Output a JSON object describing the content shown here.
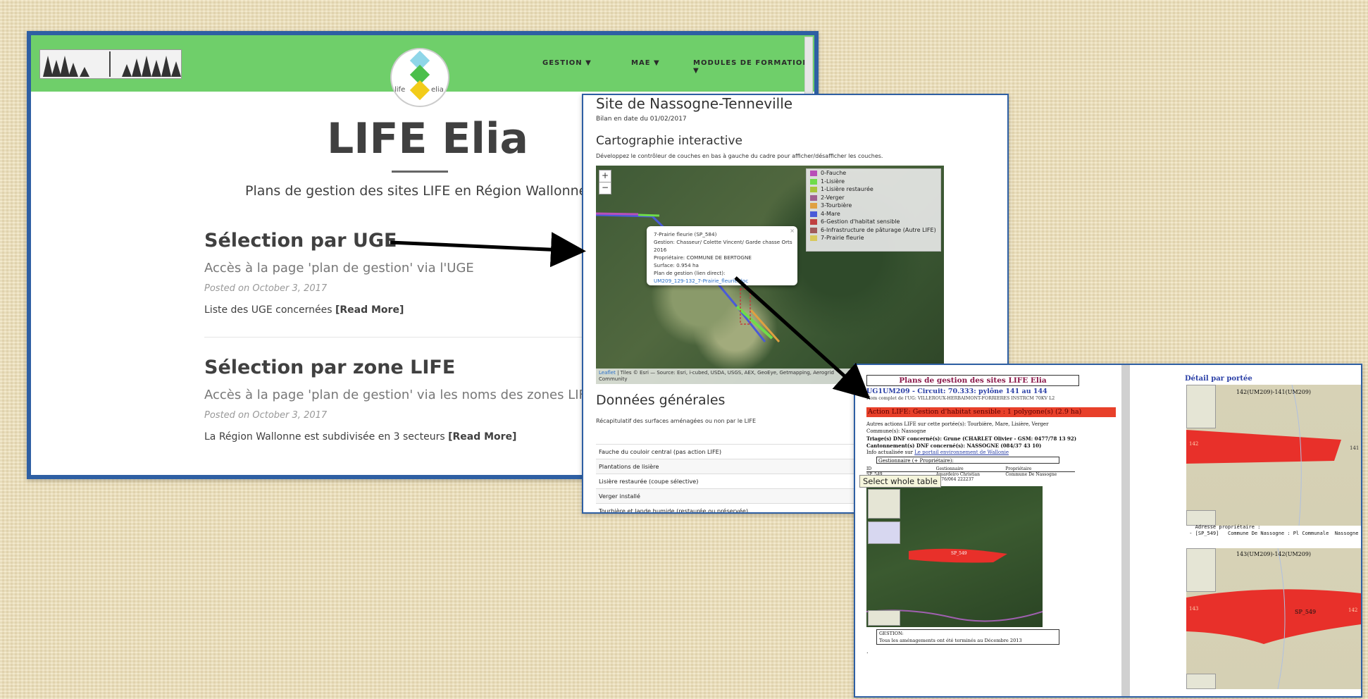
{
  "window1": {
    "nav": {
      "items": [
        "GESTION ▼",
        "MAE ▼",
        "MODULES DE FORMATION ▼"
      ]
    },
    "logo": {
      "text_left": "life",
      "text_right": "elia"
    },
    "site_title": "LIFE Elia",
    "subtitle": "Plans de gestion des sites LIFE en Région Wallonne",
    "posts": [
      {
        "title": "Sélection par UGE",
        "subtitle": "Accès à la page 'plan de gestion' via l'UGE",
        "meta": "Posted on October 3, 2017",
        "excerpt": "Liste des UGE concernées",
        "read_more": "[Read More]"
      },
      {
        "title": "Sélection par zone LIFE",
        "subtitle": "Accès à la page 'plan de gestion' via les noms des zones LIFE",
        "meta": "Posted on October 3, 2017",
        "excerpt": "La Région Wallonne est subdivisée en 3 secteurs",
        "read_more": "[Read More]"
      }
    ]
  },
  "window2": {
    "title": "Site de Nassogne-Tenneville",
    "date": "Bilan en date du 01/02/2017",
    "section1": "Cartographie interactive",
    "instructions": "Développez le contrôleur de couches en bas à gauche du cadre pour afficher/désafficher les couches.",
    "zoom_in": "+",
    "zoom_out": "−",
    "legend": [
      {
        "label": "0-Fauche",
        "color": "#b84fb8"
      },
      {
        "label": "1-Lisière",
        "color": "#6fdc4a"
      },
      {
        "label": "1-Lisière restaurée",
        "color": "#a8c43a"
      },
      {
        "label": "2-Verger",
        "color": "#a06090"
      },
      {
        "label": "3-Tourbière",
        "color": "#e0a040"
      },
      {
        "label": "4-Mare",
        "color": "#4a5ad8"
      },
      {
        "label": "6-Gestion d'habitat sensible",
        "color": "#c04040"
      },
      {
        "label": "6-Infrastructure de pâturage (Autre LIFE)",
        "color": "#a05a5a"
      },
      {
        "label": "7-Prairie fleurie",
        "color": "#d8c85a"
      }
    ],
    "popup": {
      "close": "×",
      "lines": [
        "7-Prairie fleurie (SP_584)",
        "Gestion: Chasseur/ Colette Vincent/ Garde chasse Orts",
        "2016",
        "Propriétaire: COMMUNE DE BERTOGNE",
        "Surface: 0.954 ha",
        "Plan de gestion (lien direct):"
      ],
      "link": "UM209_129-132_7-Prairie_fleurie.doc"
    },
    "attribution": {
      "leaflet": "Leaflet",
      "rest": " | Tiles © Esri — Source: Esri, i-cubed, USDA, USGS, AEX, GeoEye, Getmapping, Aerogrid",
      "line2": "Community"
    },
    "section2": "Données générales",
    "recap": "Récapitulatif des surfaces aménagées ou non par le LIFE",
    "table_rows": [
      "Fauche du couloir central (pas action LIFE)",
      "Plantations de lisière",
      "Lisière restaurée (coupe sélective)",
      "Verger installé",
      "Tourbière et lande humide (restaurée ou préservée)"
    ]
  },
  "window3": {
    "left": {
      "title": "Plans de gestion des sites LIFE Elia",
      "uge": "UG1UM209 - Circuit: 70.333: pylône 141 au 144",
      "owner_line": "Nom complet de l'UG: VILLEROUX-HERBAIMONT-FORRIERES INSTRCM 70KV L2",
      "action": "Action LIFE: Gestion d'habitat sensible : 1 polygone(s) (2.9 ha)",
      "lines": [
        "Autres actions LIFE sur cette portée(s): Tourbière, Mare, Lisière, Verger",
        "Commune(s): Nassogne",
        "Triage(s) DNF concerné(s): Grune (CHARLET Olivier - GSM: 0477/78 13 92)",
        "Cantonnement(s) DNF concerné(s): NASSOGNE (084/37 43 10)"
      ],
      "info_prefix": "Info actualisée sur",
      "info_link": "Le portail environnement de Wallonie",
      "gestionnaire": "Gestionnaire (+ Propriétaire):",
      "table_headers": [
        "ID",
        "Gestionnaire",
        "Propriétaire"
      ],
      "table_rows": [
        [
          "SP_549",
          "Amardeiro Christian",
          "Commune De Nassogne"
        ],
        [
          "",
          "0476/064 222237",
          ""
        ]
      ],
      "tooltip": "Select whole table",
      "sat_label": "SP_549",
      "gestion_title": "GESTION:",
      "gestion_text": "Tous les aménagements ont été terminés au Décembre 2013",
      "dot": "."
    },
    "right": {
      "title": "Détail par portée",
      "caption1": "142(UM209)-141(UM209)",
      "caption2": "143(UM209)-142(UM209)",
      "label_a1": "142",
      "label_b1": "141",
      "label_a2": "143",
      "label_b2": "142",
      "label_mid": "SP_549",
      "address": "   Adresse propriétaire :\n - [SP_549]   Commune De Nassogne : Pl Communale  Nassogne"
    }
  }
}
